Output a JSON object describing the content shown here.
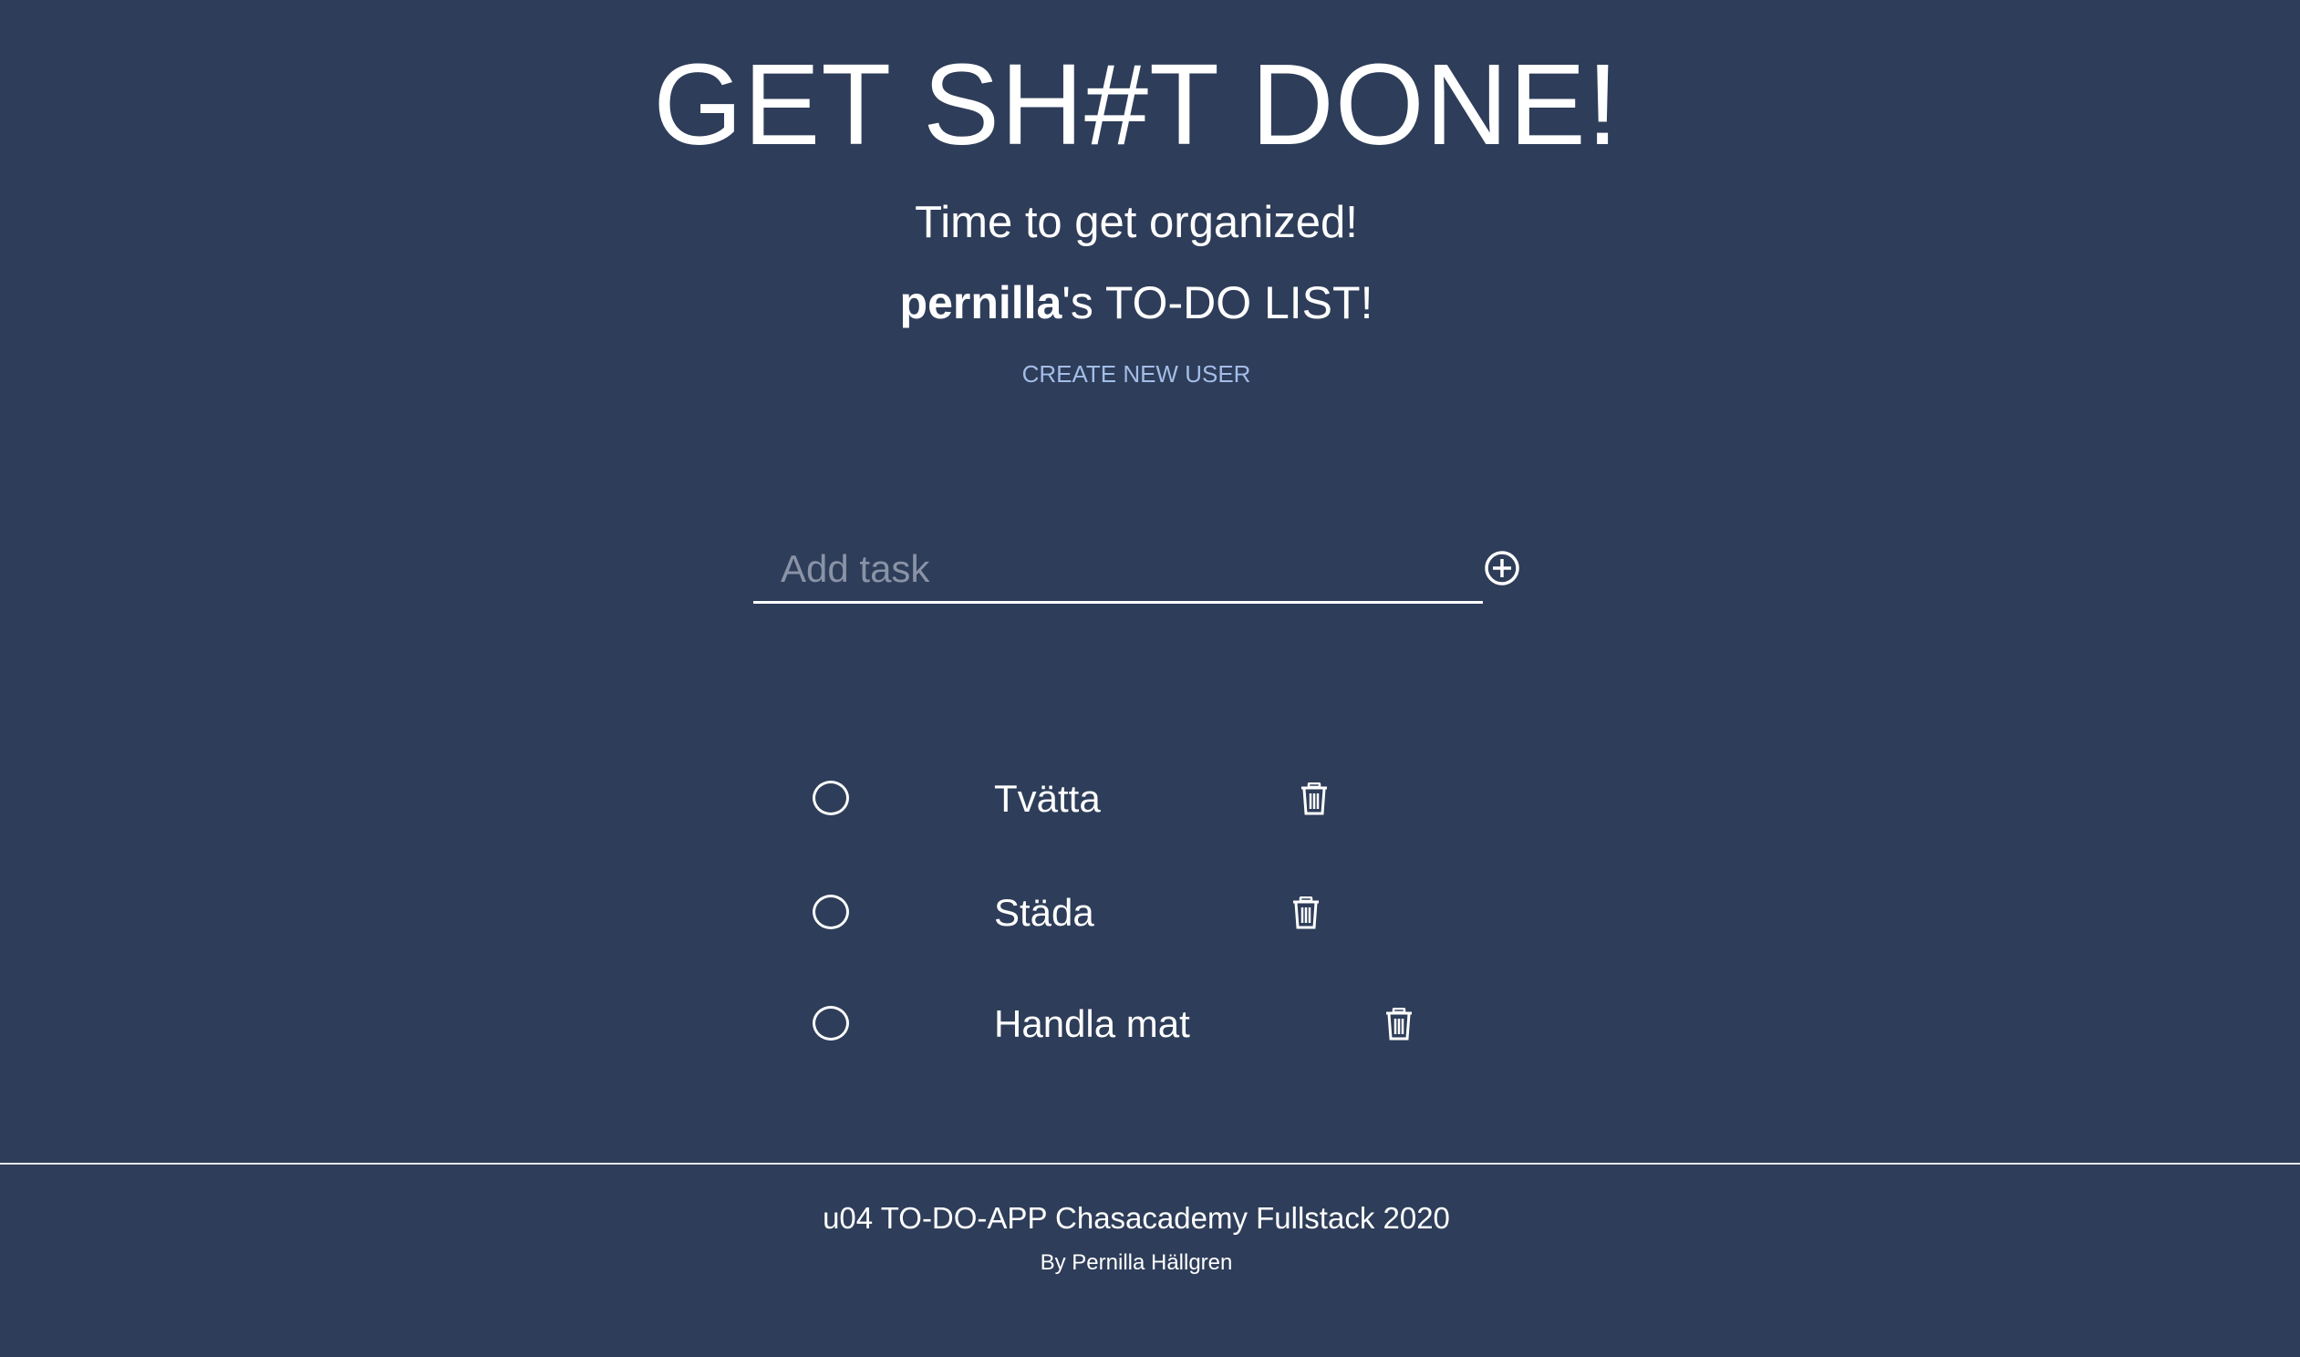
{
  "header": {
    "title": "GET SH#T DONE!",
    "subtitle": "Time to get organized!",
    "user_name": "pernilla",
    "list_title_suffix": "'s TO-DO LIST!",
    "create_user_label": "CREATE NEW USER"
  },
  "add_task": {
    "placeholder": "Add task",
    "value": "",
    "add_icon": "circle-plus-icon"
  },
  "tasks": [
    {
      "label": "Tvätta",
      "done": false
    },
    {
      "label": "Städa",
      "done": false
    },
    {
      "label": "Handla mat",
      "done": false
    }
  ],
  "icons": {
    "check": "circle-outline-icon",
    "delete": "trash-icon"
  },
  "footer": {
    "title": "u04 TO-DO-APP Chasacademy Fullstack 2020",
    "author": "By Pernilla Hällgren"
  },
  "colors": {
    "background": "#2e3d59",
    "text": "#ffffff",
    "link": "#a3bde8",
    "placeholder": "#8a93a6"
  }
}
